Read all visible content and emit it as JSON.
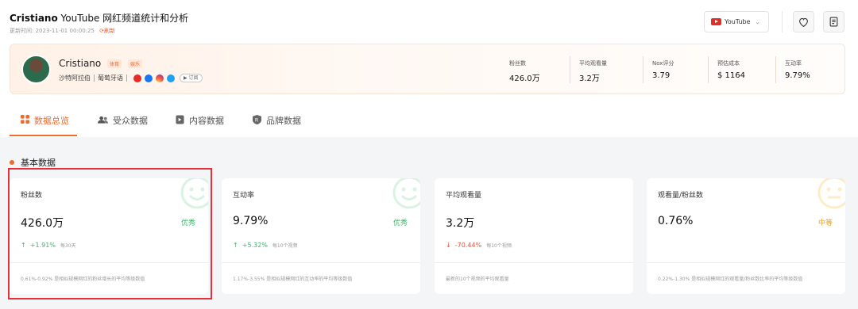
{
  "header": {
    "name_bold": "Cristiano",
    "title_rest": " YouTube 网红频道统计和分析",
    "updated": "更新时间:  2023-11-01 00:00:25",
    "refresh": "刷新",
    "platform": "YouTube"
  },
  "profile": {
    "name": "Cristiano",
    "tags": [
      "体育",
      "娱乐"
    ],
    "country": "沙特阿拉伯",
    "language": "葡萄牙语",
    "subscribe": "订阅",
    "stats": [
      {
        "label": "粉丝数",
        "value": "426.0万"
      },
      {
        "label": "平均观看量",
        "value": "3.2万"
      },
      {
        "label": "Nox评分",
        "value": "3.79"
      },
      {
        "label": "预估成本",
        "value": "$ 1164"
      },
      {
        "label": "互动率",
        "value": "9.79%"
      }
    ]
  },
  "tabs": [
    {
      "label": "数据总览",
      "icon": "grid-icon"
    },
    {
      "label": "受众数据",
      "icon": "users-icon"
    },
    {
      "label": "内容数据",
      "icon": "content-icon"
    },
    {
      "label": "品牌数据",
      "icon": "brand-icon"
    }
  ],
  "section_title": "基本数据",
  "cards": [
    {
      "label": "粉丝数",
      "value": "426.0万",
      "rating": "优秀",
      "change": "+1.91%",
      "period": "每30天",
      "note": "0.61%-0.92% 是相似规模网红的粉丝增长的平均等级数值"
    },
    {
      "label": "互动率",
      "value": "9.79%",
      "rating": "优秀",
      "change": "+5.32%",
      "period": "每10个视频",
      "note": "1.17%-3.55% 是相似规模网红的互动率的平均等级数值"
    },
    {
      "label": "平均观看量",
      "value": "3.2万",
      "rating": "",
      "change": "-70.44%",
      "period": "每10个视频",
      "note": "最新的10个视频的平均观看量"
    },
    {
      "label": "观看量/粉丝数",
      "value": "0.76%",
      "rating": "中等",
      "change": "",
      "period": "",
      "note": "0.22%-1.30% 是相似规模网红的观看量/粉丝数比率的平均等级数值"
    }
  ],
  "colors": {
    "accent": "#ef6a2b",
    "good": "#3cb56a",
    "bad": "#e8503a",
    "medium": "#f0a020",
    "highlight": "#e8303a"
  }
}
